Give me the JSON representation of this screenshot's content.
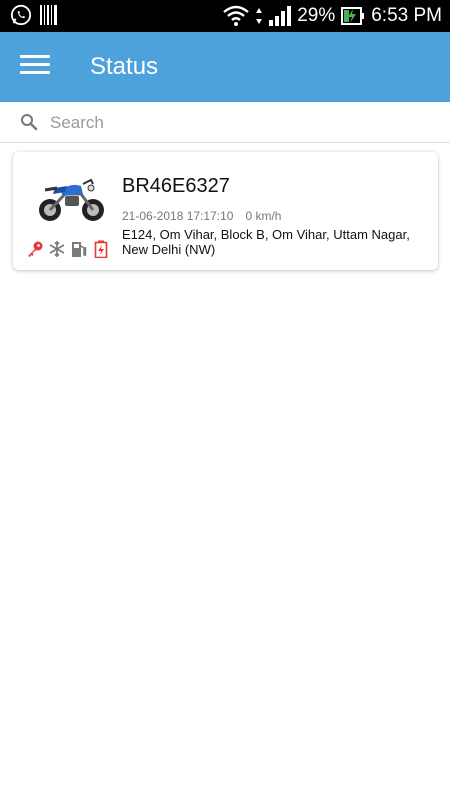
{
  "status_bar": {
    "battery_percent": "29%",
    "time": "6:53 PM",
    "icons": [
      "whatsapp-icon",
      "barcode-icon",
      "wifi-icon",
      "signal-icon",
      "battery-charging-icon"
    ]
  },
  "app_bar": {
    "title": "Status",
    "menu_icon": "hamburger-menu-icon",
    "color": "#4ea2dc"
  },
  "search": {
    "placeholder": "Search",
    "value": ""
  },
  "vehicles": [
    {
      "number": "BR46E6327",
      "timestamp": "21-06-2018 17:17:10",
      "speed": "0 km/h",
      "address": "E124, Om Vihar, Block B, Om Vihar, Uttam Nagar, New Delhi (NW)",
      "vehicle_type": "motorcycle",
      "status_icons": [
        {
          "name": "ignition-key-icon",
          "color": "#e53935"
        },
        {
          "name": "ac-snowflake-icon",
          "color": "#7a7a7a"
        },
        {
          "name": "fuel-pump-icon",
          "color": "#7a7a7a"
        },
        {
          "name": "battery-icon",
          "color": "#e53935"
        }
      ]
    }
  ]
}
